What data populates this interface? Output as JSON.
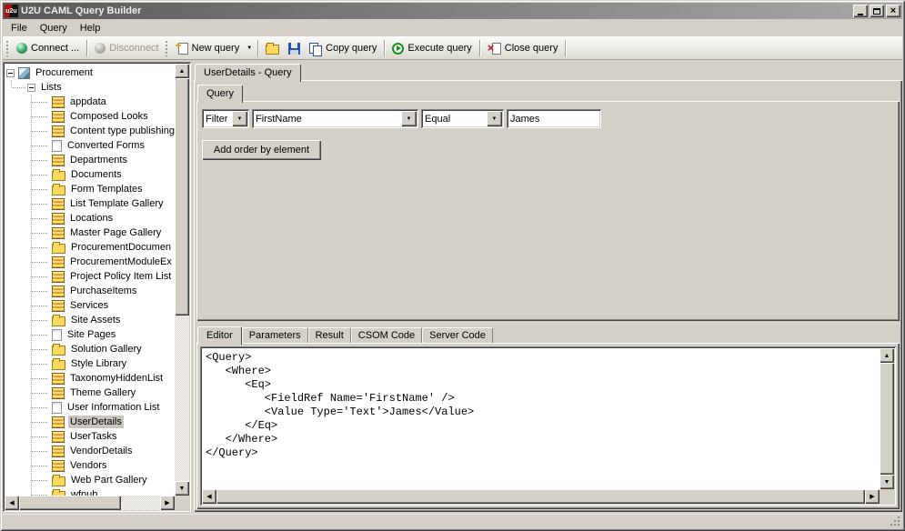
{
  "colors": {
    "window_face": "#d4d0c8",
    "titlebar_gradient_left": "#595959",
    "titlebar_gradient_right": "#a8a8a8",
    "tree_selection": "#c9c5bf",
    "list_icon_orange": "#f39c12",
    "library_icon_yellow": "#ffd95e",
    "execute_green": "#18901f",
    "close_red": "#c11e1e",
    "save_blue": "#2456b0"
  },
  "window": {
    "logo": "u2u",
    "title": "U2U CAML Query Builder"
  },
  "menu": {
    "items": [
      "File",
      "Query",
      "Help"
    ]
  },
  "toolbar": {
    "connect": "Connect ...",
    "disconnect": "Disconnect",
    "new_query": "New query",
    "copy_query": "Copy query",
    "execute_query": "Execute query",
    "close_query": "Close query"
  },
  "tree": {
    "root": "Procurement",
    "branch": "Lists",
    "items": [
      {
        "label": "appdata",
        "icon": "list"
      },
      {
        "label": "Composed Looks",
        "icon": "list"
      },
      {
        "label": "Content type publishing",
        "icon": "list"
      },
      {
        "label": "Converted Forms",
        "icon": "page"
      },
      {
        "label": "Departments",
        "icon": "list"
      },
      {
        "label": "Documents",
        "icon": "library"
      },
      {
        "label": "Form Templates",
        "icon": "library"
      },
      {
        "label": "List Template Gallery",
        "icon": "list"
      },
      {
        "label": "Locations",
        "icon": "list"
      },
      {
        "label": "Master Page Gallery",
        "icon": "list"
      },
      {
        "label": "ProcurementDocumen",
        "icon": "library"
      },
      {
        "label": "ProcurementModuleEx",
        "icon": "list"
      },
      {
        "label": "Project Policy Item List",
        "icon": "list"
      },
      {
        "label": "PurchaseItems",
        "icon": "list"
      },
      {
        "label": "Services",
        "icon": "list"
      },
      {
        "label": "Site Assets",
        "icon": "library"
      },
      {
        "label": "Site Pages",
        "icon": "page"
      },
      {
        "label": "Solution Gallery",
        "icon": "library"
      },
      {
        "label": "Style Library",
        "icon": "library"
      },
      {
        "label": "TaxonomyHiddenList",
        "icon": "list"
      },
      {
        "label": "Theme Gallery",
        "icon": "list"
      },
      {
        "label": "User Information List",
        "icon": "page"
      },
      {
        "label": "UserDetails",
        "icon": "list",
        "selected": true
      },
      {
        "label": "UserTasks",
        "icon": "list"
      },
      {
        "label": "VendorDetails",
        "icon": "list"
      },
      {
        "label": "Vendors",
        "icon": "list"
      },
      {
        "label": "Web Part Gallery",
        "icon": "library"
      },
      {
        "label": "wfpub",
        "icon": "library"
      }
    ]
  },
  "document_tab": "UserDetails - Query",
  "query_builder": {
    "tab": "Query",
    "filter_type": "Filter",
    "field": "FirstName",
    "operator": "Equal",
    "value": "James",
    "add_order_button": "Add order by element"
  },
  "bottom_tabs": [
    "Editor",
    "Parameters",
    "Result",
    "CSOM Code",
    "Server Code"
  ],
  "editor": {
    "content": "<Query>\n   <Where>\n      <Eq>\n         <FieldRef Name='FirstName' />\n         <Value Type='Text'>James</Value>\n      </Eq>\n   </Where>\n</Query>"
  }
}
